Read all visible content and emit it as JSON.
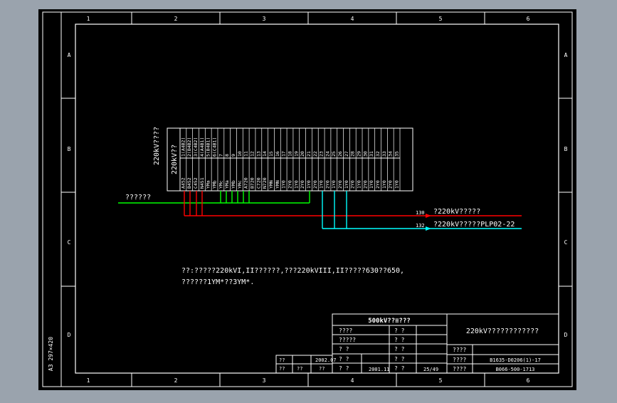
{
  "colors": {
    "background": "#000000",
    "frame": "#ffffff",
    "green_bus": "#00ff00",
    "red_bus": "#ff0000",
    "cyan_bus": "#00ffff",
    "surround": "#9aa3ad"
  },
  "border": {
    "columns": [
      "1",
      "2",
      "3",
      "4",
      "5",
      "6"
    ],
    "rows": [
      "A",
      "B",
      "C",
      "D"
    ],
    "sheet_size": "A3 297×420"
  },
  "terminal_block": {
    "side_label_1": "220kV????",
    "side_label_2": "220kV??",
    "top_labels": [
      "1(A4B2)",
      "2(B4B2)",
      "3(C4B2)",
      "4(A4B1)",
      "5(B4B1)",
      "6(C4B1)",
      "7",
      "8",
      "9",
      "10",
      "11",
      "12",
      "13",
      "14",
      "15",
      "16",
      "17",
      "18",
      "19",
      "20",
      "21",
      "22",
      "23",
      "24",
      "25",
      "26",
      "27",
      "28",
      "29",
      "30",
      "31",
      "32",
      "33",
      "34",
      "35"
    ],
    "bottom_labels": [
      "A452",
      "B452",
      "C452",
      "N451",
      "YMa",
      "YMb",
      "YMc",
      "YMa",
      "YMb",
      "YMc",
      "A720",
      "B720",
      "C720",
      "N720",
      "YMN",
      "YMN",
      "1Y0",
      "2Y0",
      "1Y0",
      "2Y0",
      "1Y0",
      "2Y0",
      "1Y0",
      "2Y0",
      "1Y0",
      "2Y0",
      "1Y0",
      "2Y0",
      "1Y0",
      "2Y0",
      "1Y0",
      "2Y0",
      "1Y0",
      "2Y0",
      "1Y0"
    ]
  },
  "wiring": {
    "green_label": "??????",
    "red_number": "130",
    "red_label": "?220kV?????",
    "cyan_number": "132",
    "cyan_label": "?220kV?????PLP02-22"
  },
  "notes": {
    "line1": "??:?????220kVI,II??????,???220kVIII,II?????630??650,",
    "line2": "??????1YM*??3YM*."
  },
  "title_block": {
    "company": "500kV??≡???",
    "drawing_title": "220kV????????????",
    "left_rows": [
      "????",
      "?????",
      "?   ?",
      "?   ?",
      "?   ?"
    ],
    "mid_rows": [
      "?  ?",
      "?  ?",
      "?  ?",
      "?  ?",
      "?  ?"
    ],
    "small_cells": [
      "??",
      "??",
      "??",
      "??",
      "??"
    ],
    "date_1": "2002.07",
    "date_2": "2001.11",
    "sheet": "25/49",
    "code_labels": [
      "????",
      "????",
      "????"
    ],
    "code_1": "B1635-D0206(1)-17",
    "code_2": "B066-500-1713"
  }
}
